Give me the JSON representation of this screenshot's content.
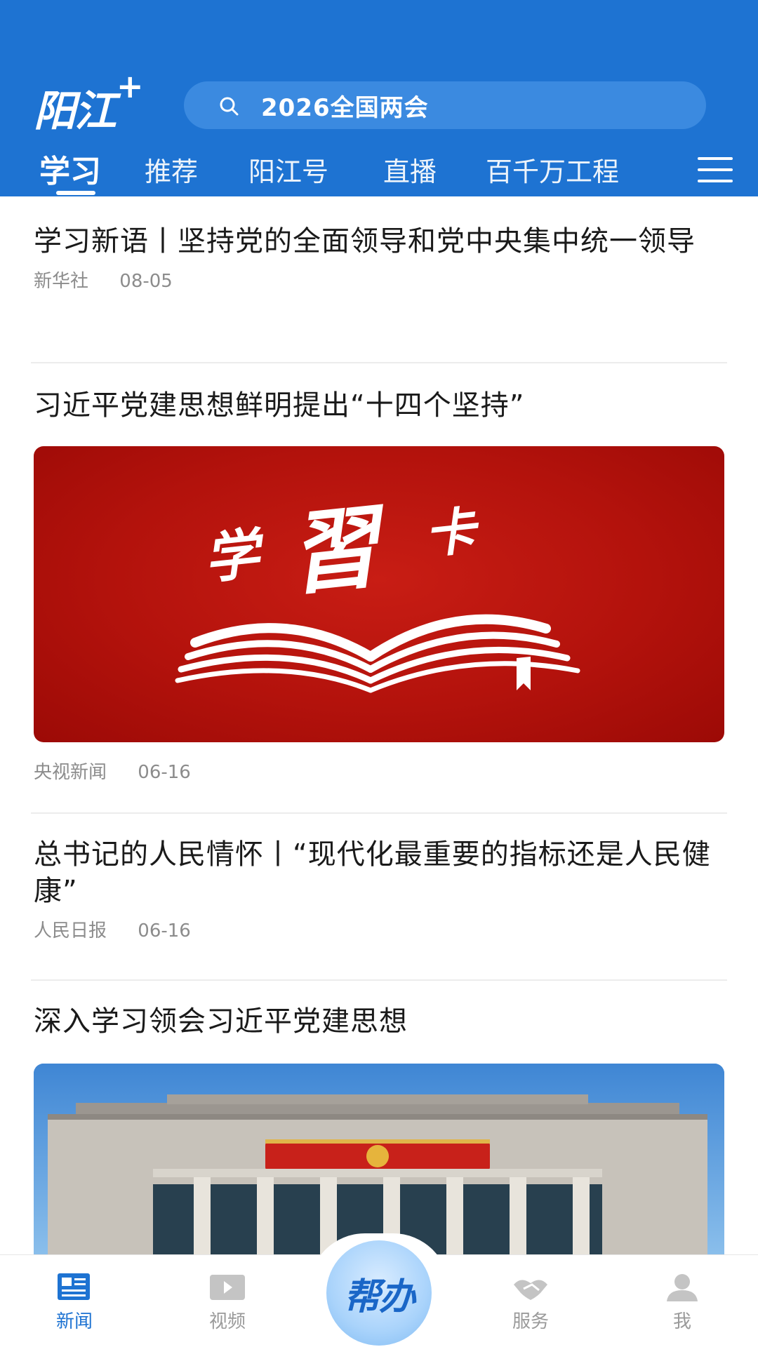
{
  "header": {
    "logo_text": "阳江",
    "logo_plus": "+",
    "search_text": "2026全国两会",
    "search_icon": "search-icon",
    "tabs": [
      {
        "label": "学习",
        "active": true
      },
      {
        "label": "推荐"
      },
      {
        "label": "阳江号"
      },
      {
        "label": "直播"
      },
      {
        "label": "百千万工程"
      }
    ],
    "menu_icon": "menu-icon",
    "bg_color": "#1e73d2"
  },
  "feed": [
    {
      "title": "学习新语丨坚持党的全面领导和党中央集中统一领导",
      "source": "新华社",
      "date": "08-05"
    },
    {
      "title": "习近平党建思想鲜明提出“十四个坚持”",
      "image": "学習卡",
      "source": "央视新闻",
      "date": "06-16"
    },
    {
      "title": "总书记的人民情怀丨“现代化最重要的指标还是人民健康”",
      "source": "人民日报",
      "date": "06-16"
    },
    {
      "title": "深入学习领会习近平党建思想",
      "image": "building-photo"
    }
  ],
  "bottom_nav": [
    {
      "label": "新闻",
      "icon": "newspaper-icon",
      "active": true
    },
    {
      "label": "视频",
      "icon": "video-icon"
    },
    {
      "label": "帮办",
      "icon": "help-center-button"
    },
    {
      "label": "服务",
      "icon": "handshake-icon"
    },
    {
      "label": "我",
      "icon": "user-icon"
    }
  ],
  "accent_color": "#1e73d2"
}
